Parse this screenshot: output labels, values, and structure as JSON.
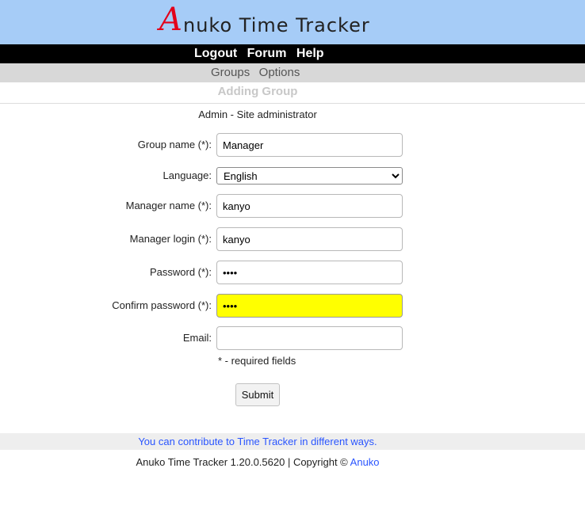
{
  "header": {
    "logo_initial": "A",
    "logo_rest": "nuko Time Tracker",
    "logo_color": "#e3001b",
    "background": "#a6ccf7"
  },
  "top_nav": {
    "items": [
      {
        "label": "Logout"
      },
      {
        "label": "Forum"
      },
      {
        "label": "Help"
      }
    ]
  },
  "sub_nav": {
    "items": [
      {
        "label": "Groups"
      },
      {
        "label": "Options"
      }
    ]
  },
  "page": {
    "title": "Adding Group",
    "user_info": "Admin - Site administrator"
  },
  "form": {
    "group_name": {
      "label": "Group name (*):",
      "value": "Manager"
    },
    "language": {
      "label": "Language:",
      "value": "English"
    },
    "manager_name": {
      "label": "Manager name (*):",
      "value": "kanyo"
    },
    "manager_login": {
      "label": "Manager login (*):",
      "value": "kanyo"
    },
    "password": {
      "label": "Password (*):",
      "value": "kany"
    },
    "confirm_password": {
      "label": "Confirm password (*):",
      "value": "kany"
    },
    "email": {
      "label": "Email:",
      "value": ""
    },
    "required_note": "* - required fields",
    "submit_label": "Submit"
  },
  "contribute": {
    "text": "You can contribute to Time Tracker in different ways."
  },
  "footer": {
    "text": "Anuko Time Tracker 1.20.0.5620 | Copyright ©",
    "link_label": "Anuko",
    "link_color": "#2a55ff"
  }
}
